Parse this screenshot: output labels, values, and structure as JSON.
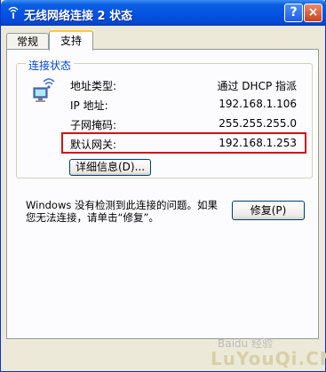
{
  "window": {
    "title": "无线网络连接 2 状态",
    "help_label": "?",
    "close_label": "×"
  },
  "tabs": [
    {
      "label": "常规"
    },
    {
      "label": "支持"
    }
  ],
  "connection_status": {
    "group_title": "连接状态",
    "rows": [
      {
        "label": "地址类型:",
        "value": "通过 DHCP 指派"
      },
      {
        "label": "IP 地址:",
        "value": "192.168.1.106"
      },
      {
        "label": "子网掩码:",
        "value": "255.255.255.0"
      },
      {
        "label": "默认网关:",
        "value": "192.168.1.253"
      }
    ],
    "details_button": "详细信息(D)..."
  },
  "message": "Windows 没有检测到此连接的问题。如果您无法连接，请单击“修复”。",
  "repair_button": "修复(P)",
  "watermark": {
    "line1": "Baidu 经验",
    "line2": "LuYouQi.CN"
  },
  "colors": {
    "title_bar": "#0554e3",
    "group_title": "#0046d5",
    "highlight_box": "#d0141a",
    "active_tab_accent": "#ffc83c"
  }
}
